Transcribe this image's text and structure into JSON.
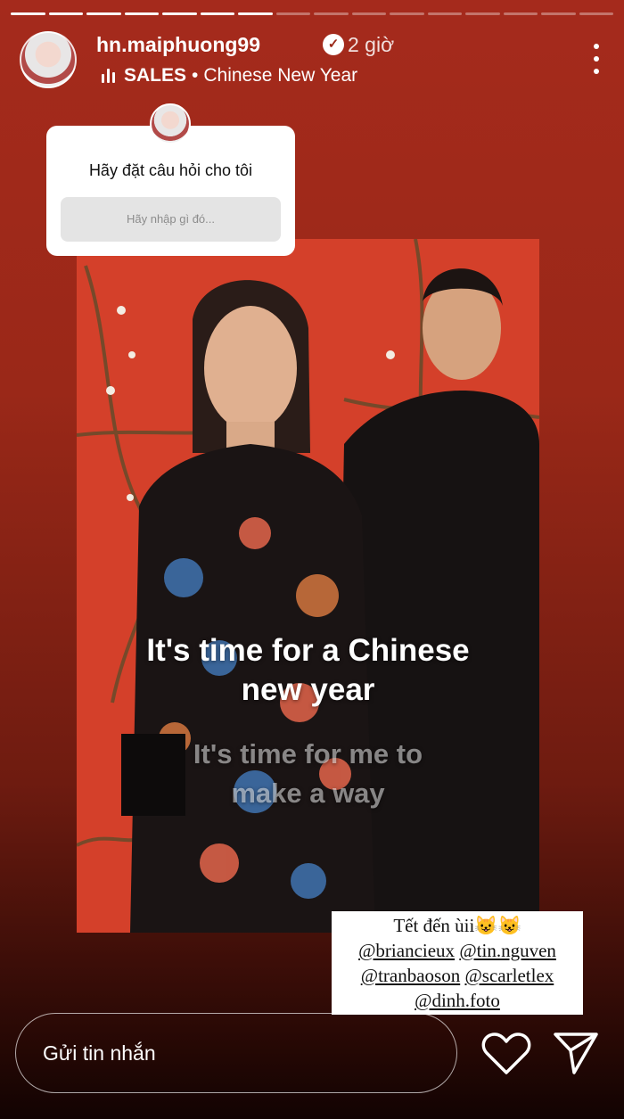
{
  "story": {
    "progress_segments": 16,
    "progress_filled": 7,
    "username": "hn.maiphuong99",
    "verified_icon": "verified-badge-icon",
    "time_ago": "2 giờ",
    "music": {
      "icon": "audio-bars-icon",
      "artist": "SALES",
      "separator": "•",
      "title": "Chinese New Year"
    },
    "more_icon": "more-vertical-icon"
  },
  "question_sticker": {
    "title": "Hãy đặt câu hỏi cho tôi",
    "placeholder": "Hãy nhập gì đó..."
  },
  "captions": {
    "line1": "It's time for a Chinese",
    "line2": "new year",
    "line3": "It's time for me to",
    "line4": "make a way"
  },
  "tag_sticker": {
    "line1": "Tết đến ùii😺😺",
    "mentions": [
      "@briancieux",
      "@tin.nguven",
      "@tranbaoson",
      "@scarletlex",
      "@dinh.foto"
    ]
  },
  "footer": {
    "message_placeholder": "Gửi tin nhắn",
    "like_icon": "heart-icon",
    "share_icon": "send-icon"
  },
  "colors": {
    "background_top": "#a52a1c",
    "background_bottom": "#120302",
    "photo_backdrop": "#d4402a"
  }
}
